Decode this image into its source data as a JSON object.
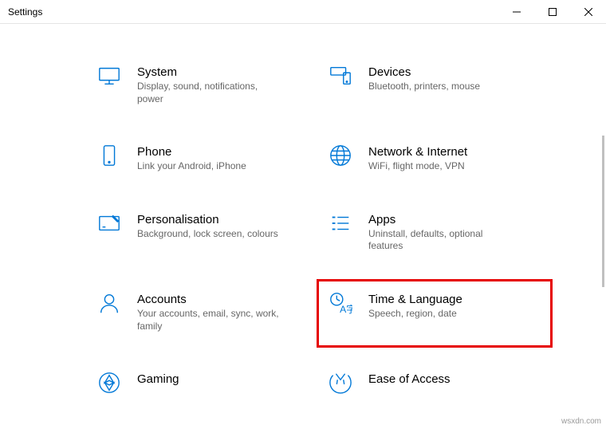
{
  "window": {
    "title": "Settings"
  },
  "categories": [
    {
      "title": "System",
      "desc": "Display, sound, notifications, power",
      "icon": "system",
      "highlighted": false
    },
    {
      "title": "Devices",
      "desc": "Bluetooth, printers, mouse",
      "icon": "devices",
      "highlighted": false
    },
    {
      "title": "Phone",
      "desc": "Link your Android, iPhone",
      "icon": "phone",
      "highlighted": false
    },
    {
      "title": "Network & Internet",
      "desc": "WiFi, flight mode, VPN",
      "icon": "network",
      "highlighted": false
    },
    {
      "title": "Personalisation",
      "desc": "Background, lock screen, colours",
      "icon": "personalisation",
      "highlighted": false
    },
    {
      "title": "Apps",
      "desc": "Uninstall, defaults, optional features",
      "icon": "apps",
      "highlighted": false
    },
    {
      "title": "Accounts",
      "desc": "Your accounts, email, sync, work, family",
      "icon": "accounts",
      "highlighted": false
    },
    {
      "title": "Time & Language",
      "desc": "Speech, region, date",
      "icon": "time-language",
      "highlighted": true
    },
    {
      "title": "Gaming",
      "desc": "",
      "icon": "gaming",
      "highlighted": false
    },
    {
      "title": "Ease of Access",
      "desc": "",
      "icon": "ease-of-access",
      "highlighted": false
    }
  ],
  "watermark": "wsxdn.com"
}
